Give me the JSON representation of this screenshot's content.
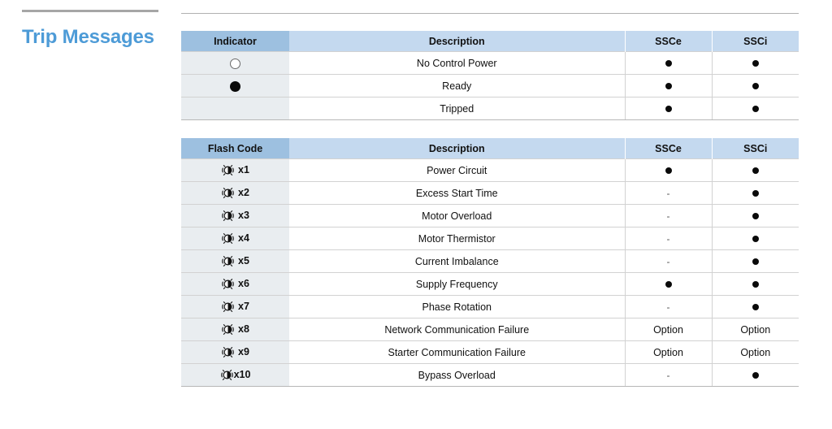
{
  "title": "Trip Messages",
  "colors": {
    "title_blue": "#4d9bd7",
    "header_dark_blue": "#9dc0e0",
    "header_light_blue": "#c4d9ef",
    "first_col_bg": "#e9edf0",
    "rule_gray": "#a6a6a6"
  },
  "indicator_table": {
    "headers": {
      "first": "Indicator",
      "description": "Description",
      "ssce": "SSCe",
      "ssci": "SSCi"
    },
    "rows": [
      {
        "indicator": "open-circle-icon",
        "description": "No Control Power",
        "ssce": "dot",
        "ssci": "dot"
      },
      {
        "indicator": "filled-circle-icon",
        "description": "Ready",
        "ssce": "dot",
        "ssci": "dot"
      },
      {
        "indicator": "none",
        "description": "Tripped",
        "ssce": "dot",
        "ssci": "dot"
      }
    ]
  },
  "flash_code_table": {
    "headers": {
      "first": "Flash Code",
      "description": "Description",
      "ssce": "SSCe",
      "ssci": "SSCi"
    },
    "rows": [
      {
        "code": "x1",
        "icon": "flashing-led-icon",
        "description": "Power Circuit",
        "ssce": "dot",
        "ssci": "dot"
      },
      {
        "code": "x2",
        "icon": "flashing-led-icon",
        "description": "Excess Start Time",
        "ssce": "dash",
        "ssci": "dot"
      },
      {
        "code": "x3",
        "icon": "flashing-led-icon",
        "description": "Motor Overload",
        "ssce": "dash",
        "ssci": "dot"
      },
      {
        "code": "x4",
        "icon": "flashing-led-icon",
        "description": "Motor Thermistor",
        "ssce": "dash",
        "ssci": "dot"
      },
      {
        "code": "x5",
        "icon": "flashing-led-icon",
        "description": "Current Imbalance",
        "ssce": "dash",
        "ssci": "dot"
      },
      {
        "code": "x6",
        "icon": "flashing-led-icon",
        "description": "Supply Frequency",
        "ssce": "dot",
        "ssci": "dot"
      },
      {
        "code": "x7",
        "icon": "flashing-led-icon",
        "description": "Phase Rotation",
        "ssce": "dash",
        "ssci": "dot"
      },
      {
        "code": "x8",
        "icon": "flashing-led-icon",
        "description": "Network Communication Failure",
        "ssce": "Option",
        "ssci": "Option"
      },
      {
        "code": "x9",
        "icon": "flashing-led-icon",
        "description": "Starter Communication Failure",
        "ssce": "Option",
        "ssci": "Option"
      },
      {
        "code": "x10",
        "icon": "flashing-led-icon",
        "description": "Bypass Overload",
        "ssce": "dash",
        "ssci": "dot"
      }
    ]
  }
}
